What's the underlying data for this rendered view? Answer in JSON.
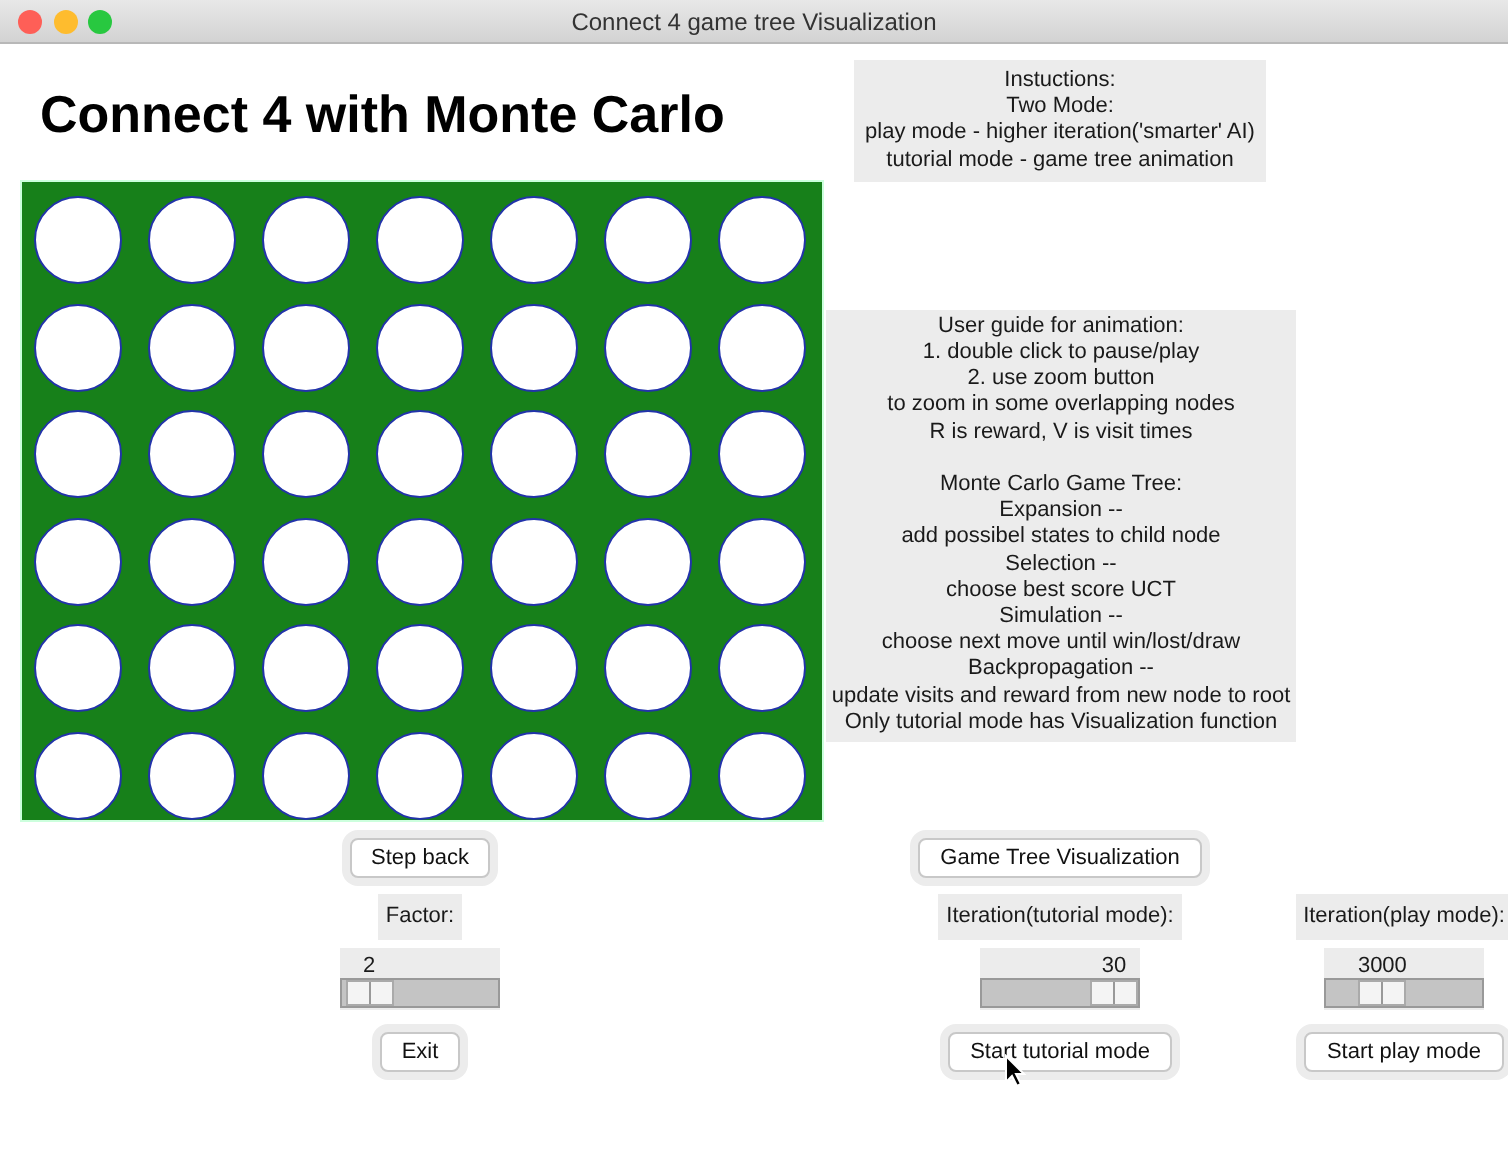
{
  "window": {
    "title": "Connect 4 game tree Visualization"
  },
  "heading": "Connect 4 with Monte Carlo",
  "instructions": [
    "Instuctions:",
    "Two Mode:",
    "play mode - higher iteration('smarter' AI)",
    "tutorial mode - game tree animation"
  ],
  "guide": [
    [
      "User guide for animation:",
      "1. double click to pause/play",
      "2. use zoom button",
      "to zoom in some overlapping nodes",
      "R is reward, V is visit times"
    ],
    [
      "Monte Carlo Game Tree:",
      "Expansion --",
      "add possibel states to child node",
      "Selection --",
      "choose best score UCT",
      "Simulation --",
      "choose next move until win/lost/draw",
      "Backpropagation --",
      "update visits and reward from new node to root",
      "Only tutorial mode has Visualization function"
    ]
  ],
  "board": {
    "rows": [
      {
        "cells": [
          {
            "kind": "empty"
          },
          {
            "kind": "empty"
          },
          {
            "kind": "empty"
          },
          {
            "kind": "empty"
          },
          {
            "kind": "empty"
          },
          {
            "kind": "empty"
          },
          {
            "kind": "empty"
          }
        ]
      },
      {
        "cells": [
          {
            "kind": "empty"
          },
          {
            "kind": "empty"
          },
          {
            "kind": "empty"
          },
          {
            "kind": "empty"
          },
          {
            "kind": "empty"
          },
          {
            "kind": "empty"
          },
          {
            "kind": "empty"
          }
        ]
      },
      {
        "cells": [
          {
            "kind": "empty"
          },
          {
            "kind": "empty"
          },
          {
            "kind": "empty"
          },
          {
            "kind": "empty"
          },
          {
            "kind": "empty"
          },
          {
            "kind": "empty"
          },
          {
            "kind": "empty"
          }
        ]
      },
      {
        "cells": [
          {
            "kind": "empty"
          },
          {
            "kind": "empty"
          },
          {
            "kind": "empty"
          },
          {
            "kind": "empty"
          },
          {
            "kind": "empty"
          },
          {
            "kind": "empty"
          },
          {
            "kind": "empty"
          }
        ]
      },
      {
        "cells": [
          {
            "kind": "empty"
          },
          {
            "kind": "empty"
          },
          {
            "kind": "empty"
          },
          {
            "kind": "empty"
          },
          {
            "kind": "empty"
          },
          {
            "kind": "empty"
          },
          {
            "kind": "empty"
          }
        ]
      },
      {
        "cells": [
          {
            "kind": "empty"
          },
          {
            "kind": "empty"
          },
          {
            "kind": "empty"
          },
          {
            "kind": "empty"
          },
          {
            "kind": "empty"
          },
          {
            "kind": "empty"
          },
          {
            "kind": "empty"
          }
        ]
      }
    ]
  },
  "controls": [
    {
      "top_button": "Step back",
      "label": "Factor:",
      "slider": {
        "reading": "2",
        "level": 0.03
      },
      "bottom_button": "Exit"
    },
    {
      "top_button": "Game Tree Visualization",
      "label": "Iteration(tutorial mode):",
      "slider": {
        "reading": "30",
        "level": 1
      },
      "bottom_button": "Start tutorial mode"
    },
    {
      "label": "Iteration(play mode):",
      "slider": {
        "reading": "3000",
        "level": 0.3
      },
      "bottom_button": "Start play mode"
    }
  ]
}
